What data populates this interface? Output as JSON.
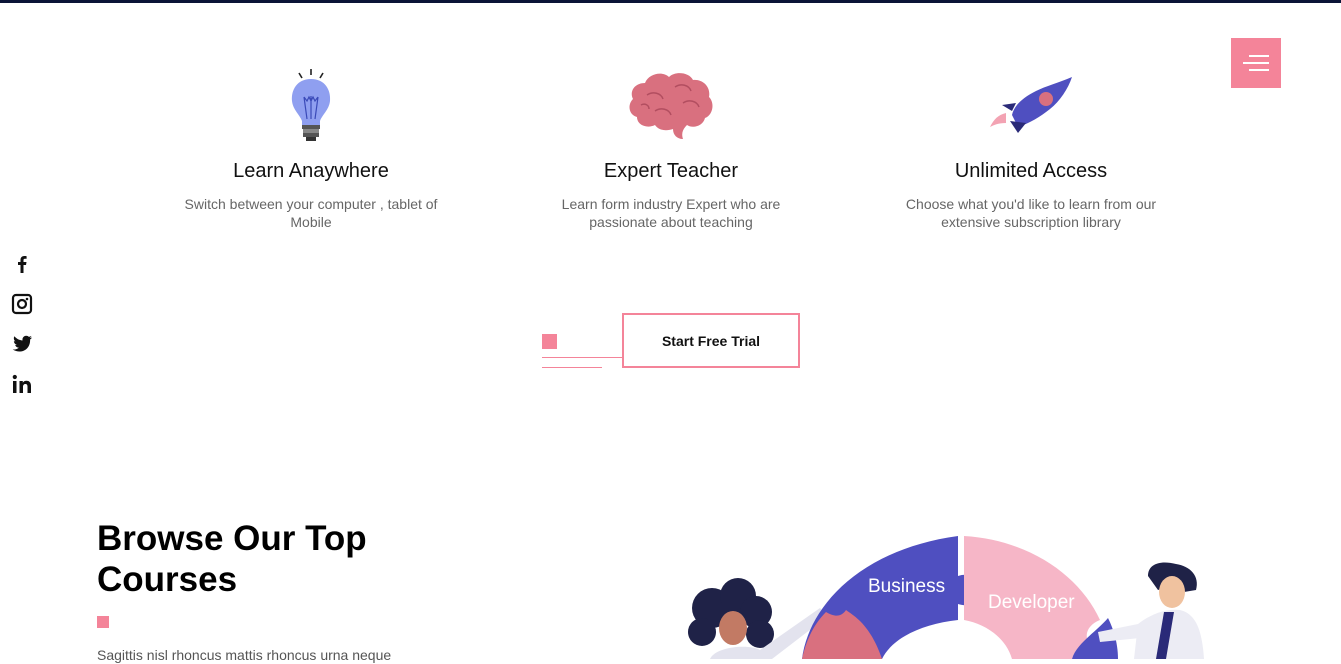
{
  "menu": {
    "icon": "hamburger-icon"
  },
  "features": [
    {
      "icon": "lightbulb-icon",
      "title": "Learn Anaywhere",
      "text": "Switch between your computer , tablet of Mobile"
    },
    {
      "icon": "brain-icon",
      "title": "Expert Teacher",
      "text": "Learn form industry Expert who are passionate about teaching"
    },
    {
      "icon": "rocket-icon",
      "title": "Unlimited Access",
      "text": "Choose what you'd like to learn from our extensive subscription library"
    }
  ],
  "social": [
    "facebook-icon",
    "instagram-icon",
    "twitter-icon",
    "linkedin-icon"
  ],
  "cta": {
    "label": "Start Free Trial"
  },
  "browse": {
    "title": "Browse Our Top Courses",
    "text": "Sagittis nisl rhoncus mattis rhoncus urna neque",
    "illustration": {
      "left_label": "Business",
      "right_label": "Developer"
    }
  },
  "colors": {
    "accent": "#f48499",
    "purple": "#4f4fc0",
    "pink_light": "#f6b6c7",
    "navy": "#0b1437"
  }
}
